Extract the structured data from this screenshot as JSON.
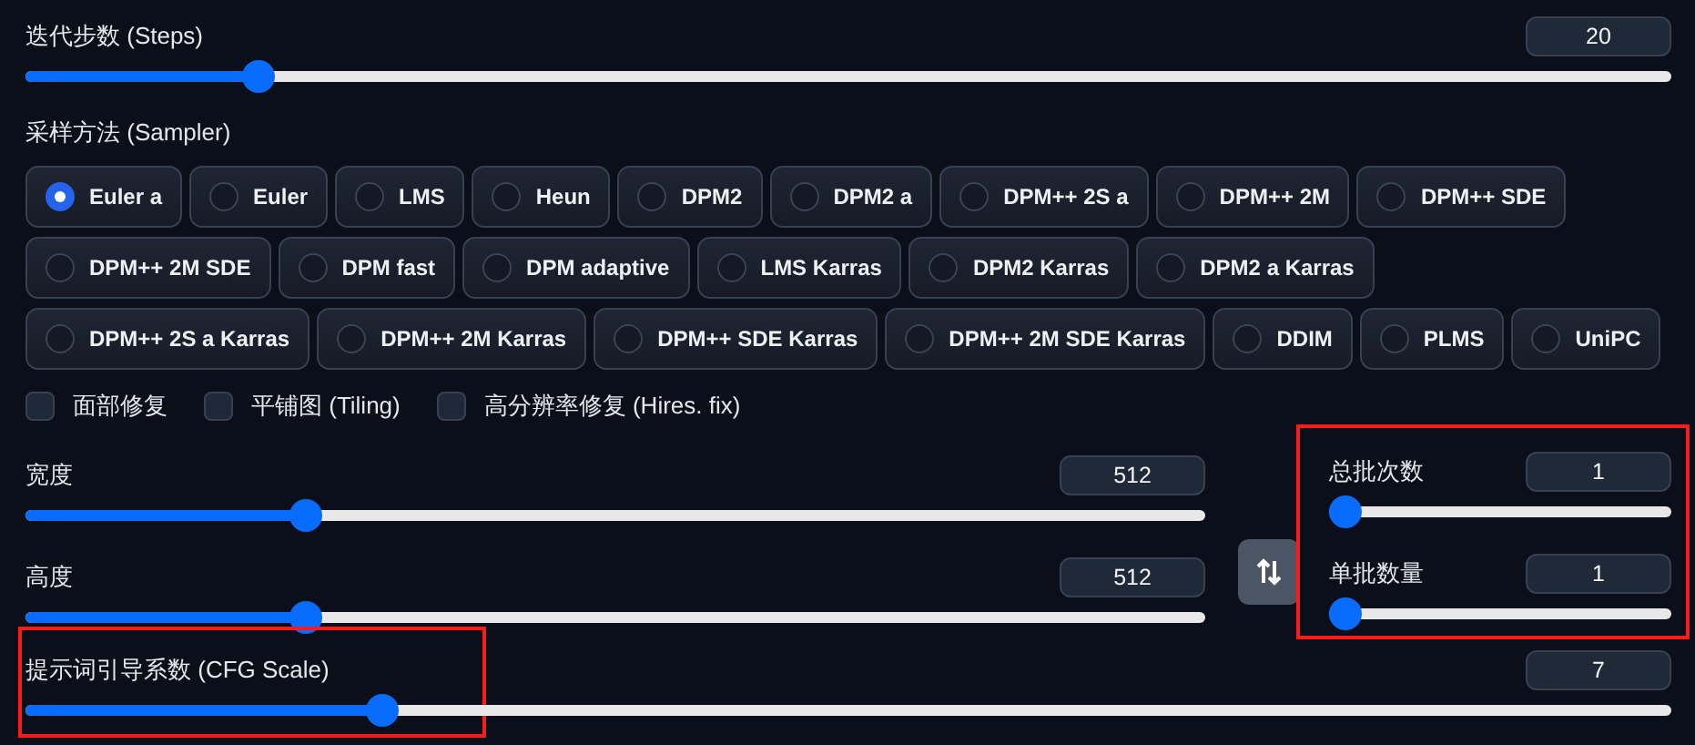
{
  "steps_slider": {
    "label": "迭代步数 (Steps)",
    "value": "20",
    "level": 0.134
  },
  "sampler": {
    "label": "采样方法 (Sampler)",
    "option_rows": [
      [
        {
          "label": "Euler a",
          "selected": true
        },
        {
          "label": "Euler",
          "selected": false
        },
        {
          "label": "LMS",
          "selected": false
        },
        {
          "label": "Heun",
          "selected": false
        },
        {
          "label": "DPM2",
          "selected": false
        },
        {
          "label": "DPM2 a",
          "selected": false
        },
        {
          "label": "DPM++ 2S a",
          "selected": false
        },
        {
          "label": "DPM++ 2M",
          "selected": false
        },
        {
          "label": "DPM++ SDE",
          "selected": false
        }
      ],
      [
        {
          "label": "DPM++ 2M SDE",
          "selected": false
        },
        {
          "label": "DPM fast",
          "selected": false
        },
        {
          "label": "DPM adaptive",
          "selected": false
        },
        {
          "label": "LMS Karras",
          "selected": false
        },
        {
          "label": "DPM2 Karras",
          "selected": false
        },
        {
          "label": "DPM2 a Karras",
          "selected": false
        }
      ],
      [
        {
          "label": "DPM++ 2S a Karras",
          "selected": false
        },
        {
          "label": "DPM++ 2M Karras",
          "selected": false
        },
        {
          "label": "DPM++ SDE Karras",
          "selected": false
        },
        {
          "label": "DPM++ 2M SDE Karras",
          "selected": false
        },
        {
          "label": "DDIM",
          "selected": false
        },
        {
          "label": "PLMS",
          "selected": false
        },
        {
          "label": "UniPC",
          "selected": false
        }
      ]
    ]
  },
  "checkboxes": [
    {
      "label": "面部修复",
      "checked": false
    },
    {
      "label": "平铺图 (Tiling)",
      "checked": false
    },
    {
      "label": "高分辨率修复 (Hires. fix)",
      "checked": false
    }
  ],
  "size_sliders": [
    {
      "label": "宽度",
      "value": "512",
      "level": 0.23
    },
    {
      "label": "高度",
      "value": "512",
      "level": 0.23
    }
  ],
  "batch_panel": {
    "highlighted": true,
    "sliders": [
      {
        "label": "总批次数",
        "value": "1",
        "level": 0
      },
      {
        "label": "单批数量",
        "value": "1",
        "level": 0
      }
    ]
  },
  "cfg_slider": {
    "label": "提示词引导系数 (CFG Scale)",
    "value": "7",
    "level": 0.211,
    "highlighted": true
  }
}
